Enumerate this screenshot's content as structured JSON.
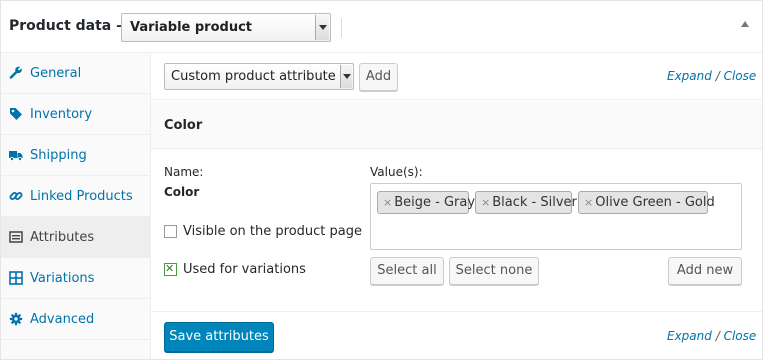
{
  "header": {
    "title": "Product data —",
    "product_type": "Variable product"
  },
  "sidebar": {
    "items": [
      {
        "label": "General",
        "icon": "wrench-icon"
      },
      {
        "label": "Inventory",
        "icon": "tag-icon"
      },
      {
        "label": "Shipping",
        "icon": "truck-icon"
      },
      {
        "label": "Linked Products",
        "icon": "link-icon"
      },
      {
        "label": "Attributes",
        "icon": "list-icon",
        "active": true
      },
      {
        "label": "Variations",
        "icon": "grid-icon"
      },
      {
        "label": "Advanced",
        "icon": "gear-icon"
      }
    ]
  },
  "toolbar": {
    "attribute_select": "Custom product attribute",
    "add_label": "Add",
    "expand_label": "Expand",
    "separator": "/",
    "close_label": "Close"
  },
  "attribute": {
    "heading": "Color",
    "name_label": "Name:",
    "name_value": "Color",
    "values_label": "Value(s):",
    "values": [
      "Beige - Gray",
      "Black - Silver",
      "Olive Green - Gold"
    ],
    "remove_glyph": "×",
    "visible_label": "Visible on the product page",
    "visible_checked": false,
    "variations_label": "Used for variations",
    "variations_checked": true,
    "select_all_label": "Select all",
    "select_none_label": "Select none",
    "add_new_label": "Add new"
  },
  "footer": {
    "save_label": "Save attributes",
    "expand_label": "Expand",
    "separator": "/",
    "close_label": "Close"
  },
  "colors": {
    "link": "#0073aa",
    "primary_button": "#0085ba",
    "active_tab_bg": "#eeeeee"
  }
}
